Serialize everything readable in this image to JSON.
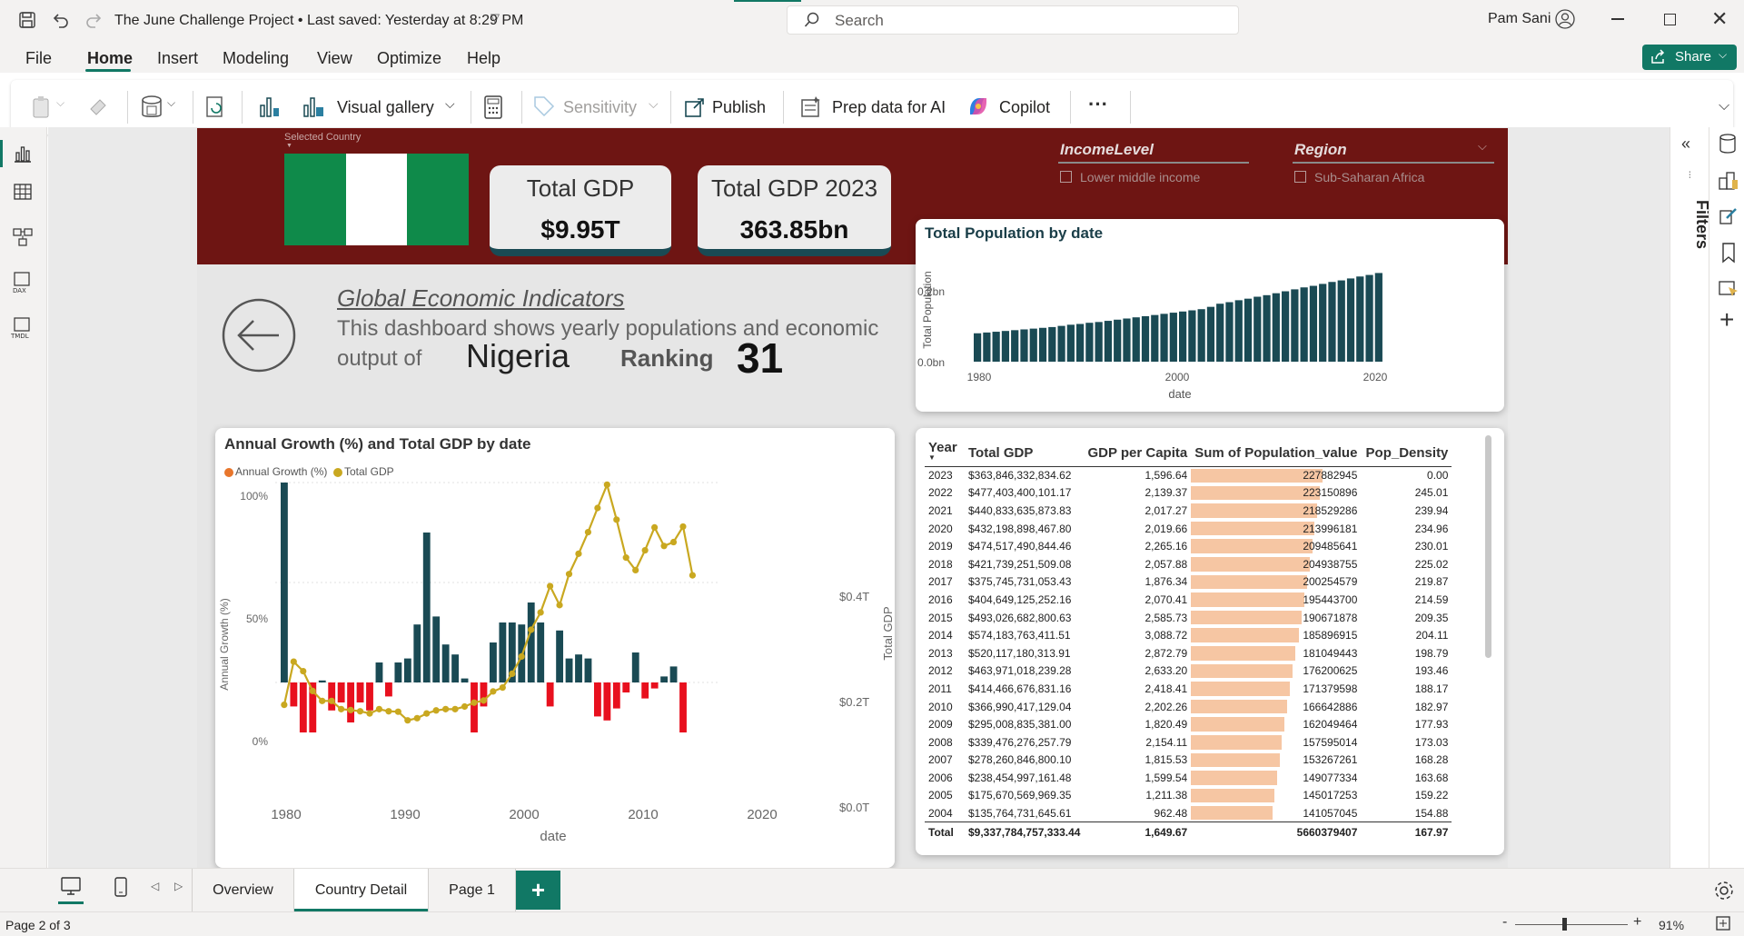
{
  "titlebar": {
    "title": "The June Challenge Project • Last saved: Yesterday at 8:29 PM",
    "search_placeholder": "Search",
    "user": "Pam Sani"
  },
  "menu": [
    "File",
    "Home",
    "Insert",
    "Modeling",
    "View",
    "Optimize",
    "Help"
  ],
  "share_label": "Share",
  "ribbon": {
    "visual_gallery": "Visual gallery",
    "sensitivity": "Sensitivity",
    "publish": "Publish",
    "prep_data": "Prep data for AI",
    "copilot": "Copilot",
    "more": "···"
  },
  "right_pane": {
    "filters_label": "Filters"
  },
  "banner": {
    "selected_country_label": "Selected Country",
    "kpis": [
      {
        "title": "Total GDP",
        "value": "$9.95T"
      },
      {
        "title": "Total GDP 2023",
        "value": "363.85bn"
      }
    ],
    "slicers": [
      {
        "title": "IncomeLevel",
        "option": "Lower middle income"
      },
      {
        "title": "Region",
        "option": "Sub-Saharan Africa"
      }
    ]
  },
  "info": {
    "heading": "Global Economic Indicators",
    "line1": "This dashboard shows yearly populations and economic",
    "line2": "output of",
    "country": "Nigeria",
    "ranking_label": "Ranking",
    "ranking_value": "31"
  },
  "colors": {
    "banner": "#6e1513",
    "teal": "#1a4a54",
    "negative": "#e8101e",
    "gdp_line": "#c9a820",
    "annual_legend": "#e8762c",
    "pop_bar": "#f6c6a3",
    "accent_green": "#117865"
  },
  "pop_chart": {
    "title": "Total Population by date",
    "ylabel": "Total Population",
    "xlabel": "date",
    "y_ticks": [
      "0.0bn",
      "0.2bn"
    ],
    "x_ticks": [
      "1980",
      "2000",
      "2020"
    ]
  },
  "growth_chart": {
    "title": "Annual Growth (%) and Total GDP by date",
    "legend": [
      "Annual Growth (%)",
      "Total GDP"
    ],
    "ylabel_left": "Annual Growth (%)",
    "ylabel_right": "Total GDP",
    "xlabel": "date",
    "y_left_ticks": [
      "100%",
      "50%",
      "0%"
    ],
    "y_right_ticks": [
      "$0.4T",
      "$0.2T",
      "$0.0T"
    ],
    "x_ticks": [
      "1980",
      "1990",
      "2000",
      "2010",
      "2020"
    ]
  },
  "chart_data": [
    {
      "type": "bar",
      "title": "Total Population by date",
      "xlabel": "date",
      "ylabel": "Total Population",
      "x": [
        1980,
        1981,
        1982,
        1983,
        1984,
        1985,
        1986,
        1987,
        1988,
        1989,
        1990,
        1991,
        1992,
        1993,
        1994,
        1995,
        1996,
        1997,
        1998,
        1999,
        2000,
        2001,
        2002,
        2003,
        2004,
        2005,
        2006,
        2007,
        2008,
        2009,
        2010,
        2011,
        2012,
        2013,
        2014,
        2015,
        2016,
        2017,
        2018,
        2019,
        2020,
        2021,
        2022,
        2023
      ],
      "values": [
        0.073,
        0.075,
        0.077,
        0.079,
        0.081,
        0.083,
        0.085,
        0.087,
        0.089,
        0.092,
        0.095,
        0.097,
        0.1,
        0.102,
        0.105,
        0.108,
        0.111,
        0.114,
        0.117,
        0.12,
        0.123,
        0.126,
        0.129,
        0.132,
        0.135,
        0.141,
        0.149,
        0.153,
        0.158,
        0.162,
        0.167,
        0.171,
        0.176,
        0.181,
        0.186,
        0.191,
        0.195,
        0.2,
        0.205,
        0.209,
        0.214,
        0.219,
        0.223,
        0.228
      ],
      "ylim": [
        0,
        0.25
      ]
    },
    {
      "type": "bar",
      "title": "Annual Growth (%) and Total GDP by date",
      "xlabel": "date",
      "x": [
        1980,
        1981,
        1982,
        1983,
        1984,
        1985,
        1986,
        1987,
        1988,
        1989,
        1990,
        1991,
        1992,
        1993,
        1994,
        1995,
        1996,
        1997,
        1998,
        1999,
        2000,
        2001,
        2002,
        2003,
        2004,
        2005,
        2006,
        2007,
        2008,
        2009,
        2010,
        2011,
        2012,
        2013,
        2014,
        2015,
        2016,
        2017,
        2018,
        2019,
        2020,
        2021,
        2022,
        2023
      ],
      "series": [
        {
          "name": "Annual Growth (%)",
          "values": [
            100,
            -12,
            -25,
            -25,
            1,
            -14,
            -10,
            -20,
            -10,
            -14,
            10,
            -7,
            10,
            12,
            29,
            75,
            33,
            19,
            14,
            2,
            -25,
            -12,
            20,
            30,
            30,
            29,
            40,
            30,
            -12,
            26,
            12,
            14,
            12,
            -17,
            -19,
            -13,
            -5,
            15,
            -8,
            -3,
            3,
            8,
            -25
          ]
        },
        {
          "name": "Total GDP",
          "values": [
            0.064,
            0.164,
            0.142,
            0.096,
            0.073,
            0.073,
            0.054,
            0.052,
            0.049,
            0.044,
            0.054,
            0.049,
            0.048,
            0.028,
            0.033,
            0.044,
            0.051,
            0.054,
            0.054,
            0.06,
            0.069,
            0.074,
            0.095,
            0.104,
            0.136,
            0.176,
            0.238,
            0.278,
            0.339,
            0.295,
            0.367,
            0.414,
            0.464,
            0.52,
            0.574,
            0.493,
            0.405,
            0.376,
            0.422,
            0.475,
            0.432,
            0.441,
            0.477,
            0.364
          ]
        }
      ],
      "ylim_left": [
        -25,
        100
      ],
      "ylim_right": [
        0,
        0.4
      ]
    }
  ],
  "table": {
    "columns": [
      "Year",
      "Total GDP",
      "GDP per Capita",
      "Sum of Population_value",
      "Pop_Density"
    ],
    "rows": [
      [
        "2023",
        "$363,846,332,834.62",
        "1,596.64",
        "227882945",
        "0.00"
      ],
      [
        "2022",
        "$477,403,400,101.17",
        "2,139.37",
        "223150896",
        "245.01"
      ],
      [
        "2021",
        "$440,833,635,873.83",
        "2,017.27",
        "218529286",
        "239.94"
      ],
      [
        "2020",
        "$432,198,898,467.80",
        "2,019.66",
        "213996181",
        "234.96"
      ],
      [
        "2019",
        "$474,517,490,844.46",
        "2,265.16",
        "209485641",
        "230.01"
      ],
      [
        "2018",
        "$421,739,251,509.08",
        "2,057.88",
        "204938755",
        "225.02"
      ],
      [
        "2017",
        "$375,745,731,053.43",
        "1,876.34",
        "200254579",
        "219.87"
      ],
      [
        "2016",
        "$404,649,125,252.16",
        "2,070.41",
        "195443700",
        "214.59"
      ],
      [
        "2015",
        "$493,026,682,800.63",
        "2,585.73",
        "190671878",
        "209.35"
      ],
      [
        "2014",
        "$574,183,763,411.51",
        "3,088.72",
        "185896915",
        "204.11"
      ],
      [
        "2013",
        "$520,117,180,313.91",
        "2,872.79",
        "181049443",
        "198.79"
      ],
      [
        "2012",
        "$463,971,018,239.28",
        "2,633.20",
        "176200625",
        "193.46"
      ],
      [
        "2011",
        "$414,466,676,831.16",
        "2,418.41",
        "171379598",
        "188.17"
      ],
      [
        "2010",
        "$366,990,417,129.04",
        "2,202.26",
        "166642886",
        "182.97"
      ],
      [
        "2009",
        "$295,008,835,381.00",
        "1,820.49",
        "162049464",
        "177.93"
      ],
      [
        "2008",
        "$339,476,276,257.79",
        "2,154.11",
        "157595014",
        "173.03"
      ],
      [
        "2007",
        "$278,260,846,800.10",
        "1,815.53",
        "153267261",
        "168.28"
      ],
      [
        "2006",
        "$238,454,997,161.48",
        "1,599.54",
        "149077334",
        "163.68"
      ],
      [
        "2005",
        "$175,670,569,969.35",
        "1,211.38",
        "145017253",
        "159.22"
      ],
      [
        "2004",
        "$135,764,731,645.61",
        "962.48",
        "141057045",
        "154.88"
      ]
    ],
    "total": [
      "Total",
      "$9,337,784,757,333.44",
      "1,649.67",
      "5660379407",
      "167.97"
    ]
  },
  "tabs": [
    "Overview",
    "Country Detail",
    "Page 1"
  ],
  "add_page": "+",
  "status": {
    "page": "Page 2 of 3",
    "zoom": "91%"
  }
}
